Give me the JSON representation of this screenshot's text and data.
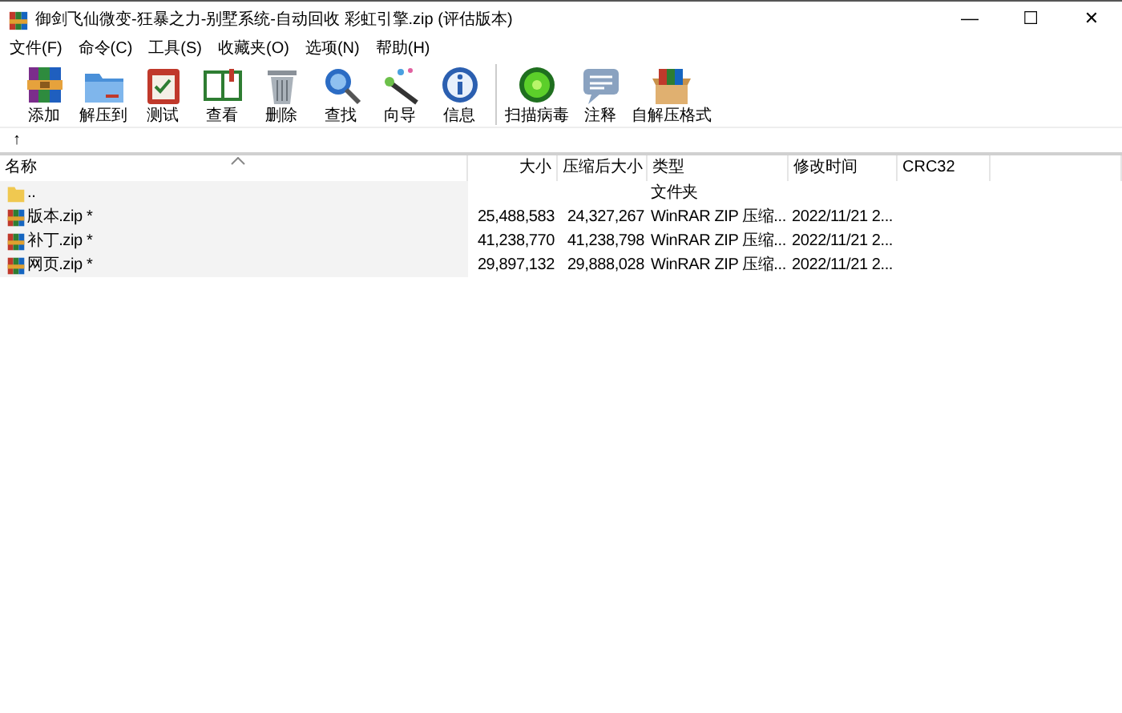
{
  "window": {
    "title": "御剑飞仙微变-狂暴之力-别墅系统-自动回收 彩虹引擎.zip (评估版本)",
    "controls": [
      "—",
      "☐",
      "✕"
    ]
  },
  "menu": [
    "文件(F)",
    "命令(C)",
    "工具(S)",
    "收藏夹(O)",
    "选项(N)",
    "帮助(H)"
  ],
  "toolbar": [
    {
      "kind": "add",
      "label": "添加"
    },
    {
      "kind": "extract",
      "label": "解压到"
    },
    {
      "kind": "test",
      "label": "测试"
    },
    {
      "kind": "view",
      "label": "查看"
    },
    {
      "kind": "delete",
      "label": "删除"
    },
    {
      "kind": "find",
      "label": "查找"
    },
    {
      "kind": "wizard",
      "label": "向导"
    },
    {
      "kind": "info",
      "label": "信息",
      "separator_after": true
    },
    {
      "kind": "virus",
      "label": "扫描病毒"
    },
    {
      "kind": "comment",
      "label": "注释"
    },
    {
      "kind": "sfx",
      "label": "自解压格式"
    }
  ],
  "address_bar": {
    "up_button": "↑"
  },
  "table": {
    "columns": [
      "名称",
      "大小",
      "压缩后大小",
      "类型",
      "修改时间",
      "CRC32"
    ],
    "rows": [
      {
        "kind": "folder",
        "name": "..",
        "type": "文件夹"
      },
      {
        "kind": "archive",
        "name": "版本.zip *",
        "size": "25,488,583",
        "packed": "24,327,267",
        "type": "WinRAR ZIP 压缩...",
        "modified": "2022/11/21 2..."
      },
      {
        "kind": "archive",
        "name": "补丁.zip *",
        "size": "41,238,770",
        "packed": "41,238,798",
        "type": "WinRAR ZIP 压缩...",
        "modified": "2022/11/21 2..."
      },
      {
        "kind": "archive",
        "name": "网页.zip *",
        "size": "29,897,132",
        "packed": "29,888,028",
        "type": "WinRAR ZIP 压缩...",
        "modified": "2022/11/21 2..."
      }
    ]
  }
}
